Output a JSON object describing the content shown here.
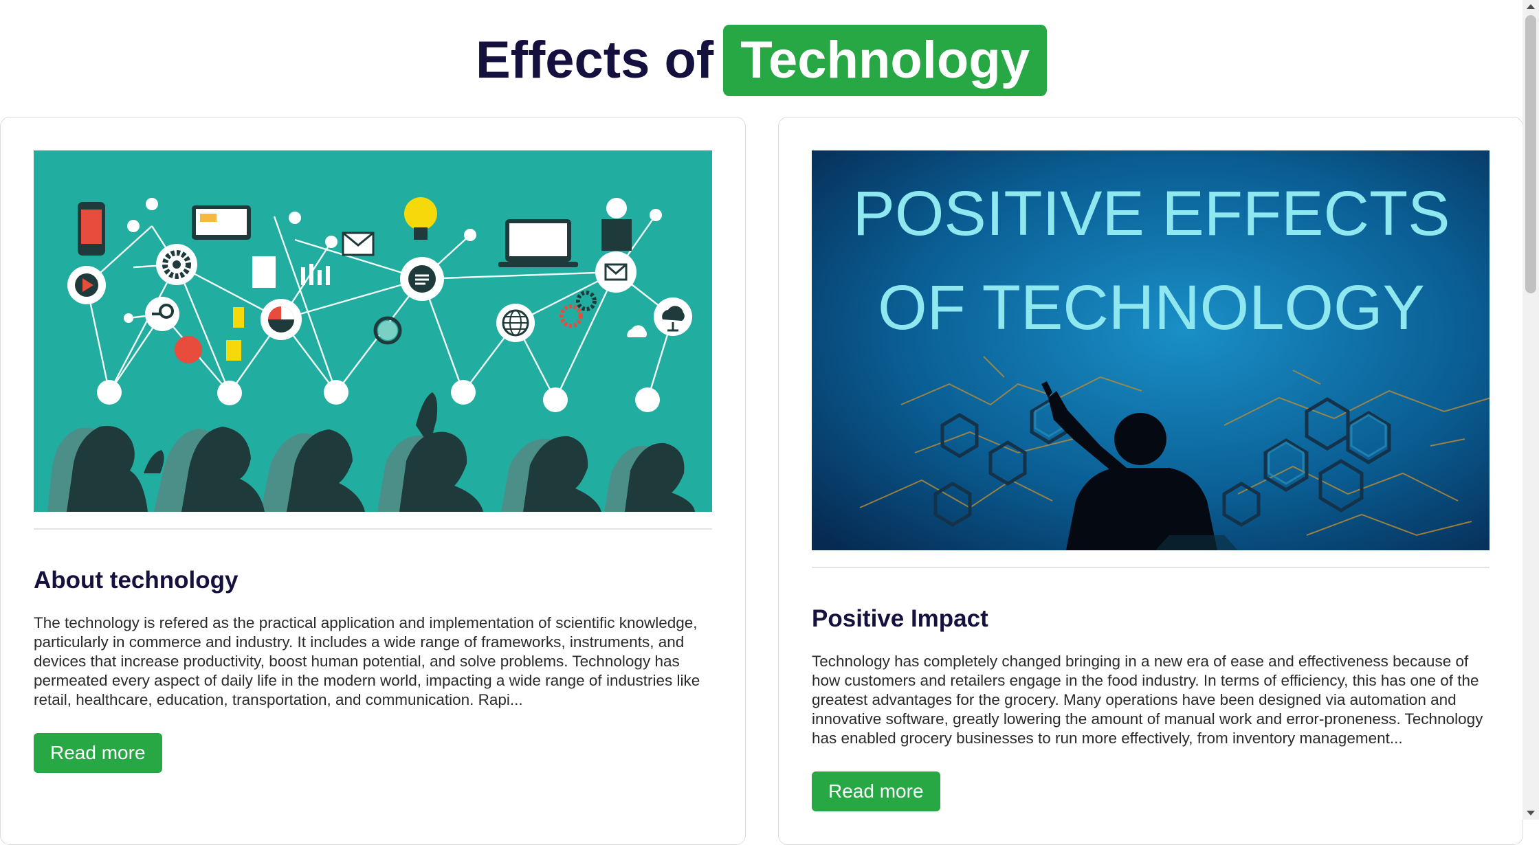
{
  "header": {
    "title_lead": "Effects of",
    "title_highlight": "Technology"
  },
  "cards": [
    {
      "image_alt": "Illustration of silhouetted people with connected technology icons",
      "title": "About technology",
      "text": "The technology is refered as the practical application and implementation of scientific knowledge, particularly in commerce and industry. It includes a wide range of frameworks, instruments, and devices that increase productivity, boost human potential, and solve problems. Technology has permeated every aspect of daily life in the modern world, impacting a wide range of industries like retail, healthcare, education, transportation, and communication. Rapi...",
      "button": "Read more"
    },
    {
      "image_alt": "Silhouette touching a glowing hexagon network",
      "image_heading_line1": "POSITIVE EFFECTS",
      "image_heading_line2": "OF TECHNOLOGY",
      "title": "Positive Impact",
      "text": "Technology has completely changed bringing in a new era of ease and effectiveness because of how customers and retailers engage in the food industry. In terms of efficiency, this has one of the greatest advantages for the grocery. Many operations have been designed via automation and innovative software, greatly lowering the amount of manual work and error-proneness. Technology has enabled grocery businesses to run more effectively, from inventory management...",
      "button": "Read more"
    }
  ],
  "colors": {
    "accent": "#28a745",
    "title": "#14113f",
    "image1_bg": "#21ada0",
    "image2_bg": "#0a5f95"
  }
}
